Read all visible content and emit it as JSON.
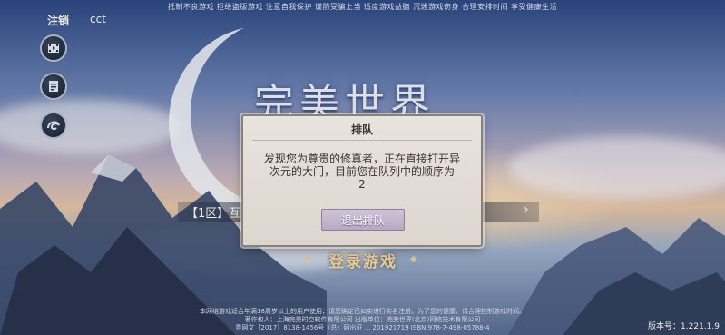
{
  "top_notice": "抵制不良游戏 拒绝盗版游戏 注意自我保护 谨防受骗上当 适度游戏益脑 沉迷游戏伤身 合理安排时间 享受健康生活",
  "account": {
    "logout_label": "注销",
    "username": "cct"
  },
  "side_buttons": [
    {
      "icon": "film-icon"
    },
    {
      "icon": "notice-icon"
    },
    {
      "icon": "swirl-icon"
    }
  ],
  "logo_text": "完美世界",
  "server": {
    "label": "【1区】互",
    "arrow": "›"
  },
  "login_button": {
    "label": "登录游戏"
  },
  "dialog": {
    "title": "排队",
    "message": "发现您为尊贵的修真者，正在直接打开异次元的大门，目前您在队列中的顺序为",
    "queue_position": "2",
    "exit_button": "退出排队"
  },
  "footer": {
    "line1": "本网络游戏适合年满18周岁以上的用户使用；请您确定已如实进行实名注册。为了您的健康，请合理控制游戏时间。",
    "line2": "著作权人：上海完美时空软件有限公司 出版单位：完美世界(北京)网络技术有限公司",
    "line3": "粤网文［2017］8138-1456号（总）网出证 ... 201921719 ISBN 978-7-498-05788-4"
  },
  "version": "版本号：1.221.1.9"
}
